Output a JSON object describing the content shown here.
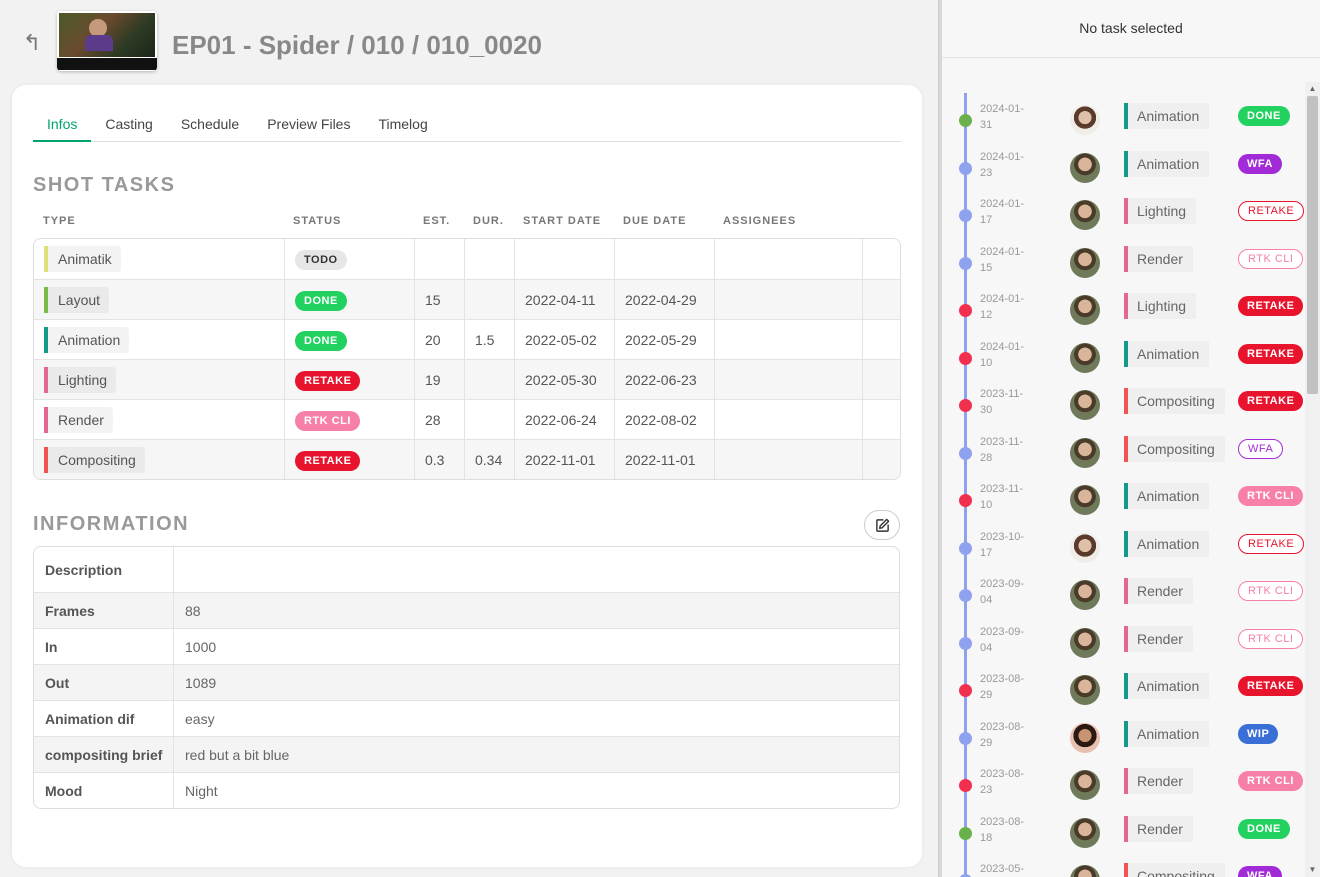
{
  "header": {
    "back_icon": "↰",
    "title": "EP01 - Spider / 010 / 010_0020"
  },
  "tabs": [
    "Infos",
    "Casting",
    "Schedule",
    "Preview Files",
    "Timelog"
  ],
  "shot_tasks": {
    "title": "SHOT TASKS",
    "columns": [
      "TYPE",
      "STATUS",
      "EST.",
      "DUR.",
      "START DATE",
      "DUE DATE",
      "ASSIGNEES"
    ],
    "rows": [
      {
        "type": "Animatik",
        "type_color": "#e0e07a",
        "status": "TODO",
        "status_color": "#e6e6e6",
        "status_text_color": "#333",
        "outline": false,
        "est": "",
        "dur": "",
        "start": "",
        "due": ""
      },
      {
        "type": "Layout",
        "type_color": "#7cba47",
        "status": "DONE",
        "status_color": "#22d160",
        "status_text_color": "#fff",
        "outline": false,
        "est": "15",
        "dur": "",
        "start": "2022-04-11",
        "due": "2022-04-29"
      },
      {
        "type": "Animation",
        "type_color": "#14998a",
        "status": "DONE",
        "status_color": "#22d160",
        "status_text_color": "#fff",
        "outline": false,
        "est": "20",
        "dur": "1.5",
        "start": "2022-05-02",
        "due": "2022-05-29"
      },
      {
        "type": "Lighting",
        "type_color": "#e2688e",
        "status": "RETAKE",
        "status_color": "#e8132c",
        "status_text_color": "#fff",
        "outline": false,
        "est": "19",
        "dur": "",
        "start": "2022-05-30",
        "due": "2022-06-23"
      },
      {
        "type": "Render",
        "type_color": "#e2688e",
        "status": "RTK CLI",
        "status_color": "#f780a8",
        "status_text_color": "#fff",
        "outline": false,
        "est": "28",
        "dur": "",
        "start": "2022-06-24",
        "due": "2022-08-02"
      },
      {
        "type": "Compositing",
        "type_color": "#f25454",
        "status": "RETAKE",
        "status_color": "#e8132c",
        "status_text_color": "#fff",
        "outline": false,
        "est": "0.3",
        "dur": "0.34",
        "start": "2022-11-01",
        "due": "2022-11-01"
      }
    ]
  },
  "information": {
    "title": "INFORMATION",
    "edit_icon": "edit-icon",
    "rows": [
      {
        "key": "Description",
        "value": ""
      },
      {
        "key": "Frames",
        "value": "88"
      },
      {
        "key": "In",
        "value": "1000"
      },
      {
        "key": "Out",
        "value": "1089"
      },
      {
        "key": "Animation dif",
        "value": "easy"
      },
      {
        "key": "compositing brief",
        "value": "red but a bit blue"
      },
      {
        "key": "Mood",
        "value": "Night"
      }
    ]
  },
  "right_panel": {
    "header": "No task selected",
    "entries": [
      {
        "date": "2024-01-31",
        "dot": "#6ab04c",
        "avatar": "b",
        "task": "Animation",
        "task_color": "#14998a",
        "status": "DONE",
        "status_color": "#22d160",
        "outline": false
      },
      {
        "date": "2024-01-23",
        "dot": "#8fa2ef",
        "avatar": "a",
        "task": "Animation",
        "task_color": "#14998a",
        "status": "WFA",
        "status_color": "#a22bd8",
        "outline": false
      },
      {
        "date": "2024-01-17",
        "dot": "#8fa2ef",
        "avatar": "a",
        "task": "Lighting",
        "task_color": "#e2688e",
        "status": "RETAKE",
        "status_color": "#e8132c",
        "outline": true
      },
      {
        "date": "2024-01-15",
        "dot": "#8fa2ef",
        "avatar": "a",
        "task": "Render",
        "task_color": "#e2688e",
        "status": "RTK CLI",
        "status_color": "#f780a8",
        "outline": true
      },
      {
        "date": "2024-01-12",
        "dot": "#f0304e",
        "avatar": "a",
        "task": "Lighting",
        "task_color": "#e2688e",
        "status": "RETAKE",
        "status_color": "#e8132c",
        "outline": false
      },
      {
        "date": "2024-01-10",
        "dot": "#f0304e",
        "avatar": "a",
        "task": "Animation",
        "task_color": "#14998a",
        "status": "RETAKE",
        "status_color": "#e8132c",
        "outline": false
      },
      {
        "date": "2023-11-30",
        "dot": "#f0304e",
        "avatar": "a",
        "task": "Compositing",
        "task_color": "#f25454",
        "status": "RETAKE",
        "status_color": "#e8132c",
        "outline": false
      },
      {
        "date": "2023-11-28",
        "dot": "#8fa2ef",
        "avatar": "a",
        "task": "Compositing",
        "task_color": "#f25454",
        "status": "WFA",
        "status_color": "#a22bd8",
        "outline": true
      },
      {
        "date": "2023-11-10",
        "dot": "#f0304e",
        "avatar": "a",
        "task": "Animation",
        "task_color": "#14998a",
        "status": "RTK CLI",
        "status_color": "#f780a8",
        "outline": false
      },
      {
        "date": "2023-10-17",
        "dot": "#8fa2ef",
        "avatar": "b",
        "task": "Animation",
        "task_color": "#14998a",
        "status": "RETAKE",
        "status_color": "#e8132c",
        "outline": true
      },
      {
        "date": "2023-09-04",
        "dot": "#8fa2ef",
        "avatar": "a",
        "task": "Render",
        "task_color": "#e2688e",
        "status": "RTK CLI",
        "status_color": "#f780a8",
        "outline": true
      },
      {
        "date": "2023-09-04",
        "dot": "#8fa2ef",
        "avatar": "a",
        "task": "Render",
        "task_color": "#e2688e",
        "status": "RTK CLI",
        "status_color": "#f780a8",
        "outline": true
      },
      {
        "date": "2023-08-29",
        "dot": "#f0304e",
        "avatar": "a",
        "task": "Animation",
        "task_color": "#14998a",
        "status": "RETAKE",
        "status_color": "#e8132c",
        "outline": false
      },
      {
        "date": "2023-08-29",
        "dot": "#8fa2ef",
        "avatar": "c",
        "task": "Animation",
        "task_color": "#14998a",
        "status": "WIP",
        "status_color": "#3a6fd8",
        "outline": false
      },
      {
        "date": "2023-08-23",
        "dot": "#f0304e",
        "avatar": "a",
        "task": "Render",
        "task_color": "#e2688e",
        "status": "RTK CLI",
        "status_color": "#f780a8",
        "outline": false
      },
      {
        "date": "2023-08-18",
        "dot": "#6ab04c",
        "avatar": "a",
        "task": "Render",
        "task_color": "#e2688e",
        "status": "DONE",
        "status_color": "#22d160",
        "outline": false
      },
      {
        "date": "2023-05-",
        "dot": "#8fa2ef",
        "avatar": "a",
        "task": "Compositing",
        "task_color": "#f25454",
        "status": "WFA",
        "status_color": "#a22bd8",
        "outline": false
      }
    ]
  }
}
